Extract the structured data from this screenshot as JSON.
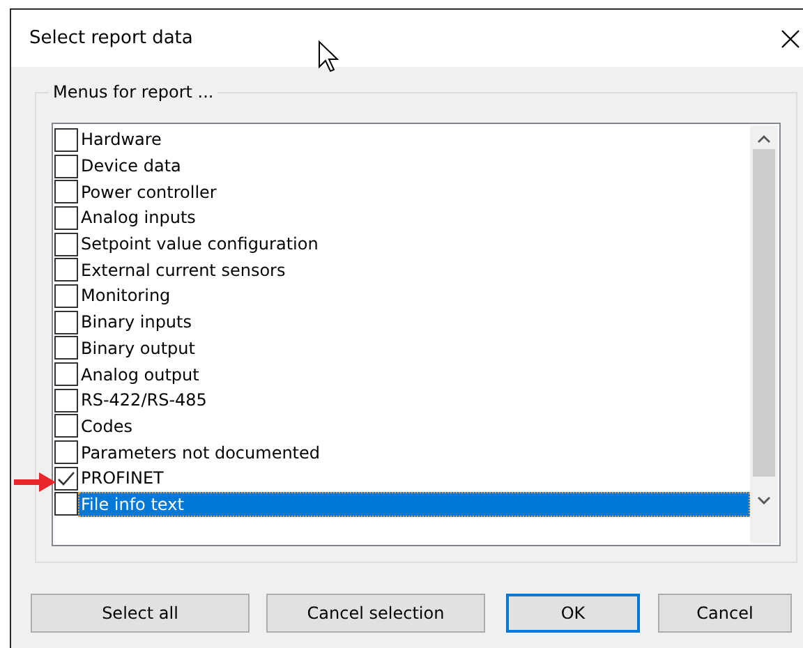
{
  "window": {
    "title": "Select report data"
  },
  "group": {
    "title": "Menus for report ..."
  },
  "items": [
    {
      "label": "Hardware",
      "checked": false,
      "selected": false
    },
    {
      "label": "Device data",
      "checked": false,
      "selected": false
    },
    {
      "label": "Power controller",
      "checked": false,
      "selected": false
    },
    {
      "label": "Analog inputs",
      "checked": false,
      "selected": false
    },
    {
      "label": "Setpoint value configuration",
      "checked": false,
      "selected": false
    },
    {
      "label": "External current sensors",
      "checked": false,
      "selected": false
    },
    {
      "label": "Monitoring",
      "checked": false,
      "selected": false
    },
    {
      "label": "Binary inputs",
      "checked": false,
      "selected": false
    },
    {
      "label": "Binary output",
      "checked": false,
      "selected": false
    },
    {
      "label": "Analog output",
      "checked": false,
      "selected": false
    },
    {
      "label": "RS-422/RS-485",
      "checked": false,
      "selected": false
    },
    {
      "label": "Codes",
      "checked": false,
      "selected": false
    },
    {
      "label": "Parameters not documented",
      "checked": false,
      "selected": false
    },
    {
      "label": "PROFINET",
      "checked": true,
      "selected": false
    },
    {
      "label": "File info text",
      "checked": false,
      "selected": true
    }
  ],
  "buttons": [
    {
      "label": "Select all",
      "default": false
    },
    {
      "label": "Cancel selection",
      "default": false
    },
    {
      "label": "OK",
      "default": true
    },
    {
      "label": "Cancel",
      "default": false
    }
  ]
}
